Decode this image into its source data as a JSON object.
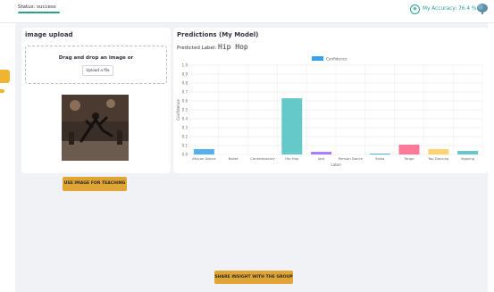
{
  "header": {
    "status": "Status: success",
    "accuracy": "My Accuracy: 76.4 %",
    "accuracy_icon": "circle-icon",
    "brain_icon": "brain-icon"
  },
  "upload": {
    "title": "image upload",
    "drop_text": "Drag and drop an image or",
    "button_label": "Upload a file"
  },
  "actions": {
    "teach_label": "USE IMAGE FOR TEACHING",
    "share_label": "SHARE INSIGHT WITH THE GROUP"
  },
  "predictions": {
    "title": "Predictions (My Model)",
    "label_prefix": "Predicted Label:",
    "label_value": "Hip Hop"
  },
  "colors": {
    "accent": "#2aa198",
    "button": "#e0a534"
  },
  "chart_data": {
    "type": "bar",
    "title": "",
    "xlabel": "Label",
    "ylabel": "Confidence",
    "ylim": [
      0,
      1.0
    ],
    "yticks": [
      "0.0",
      "0.1",
      "0.2",
      "0.3",
      "0.4",
      "0.5",
      "0.6",
      "0.7",
      "0.8",
      "0.9",
      "1.0"
    ],
    "legend": "Confidence",
    "legend_position": "top-center",
    "grid": true,
    "categories": [
      "African Dance",
      "Ballet",
      "Contemporary",
      "Hip Hop",
      "Jazz",
      "Persian Dance",
      "Salsa",
      "Tango",
      "Tap Dancing",
      "Voguing"
    ],
    "values": [
      0.06,
      0.0,
      0.0,
      0.63,
      0.03,
      0.0,
      0.01,
      0.11,
      0.06,
      0.04
    ],
    "bar_colors": [
      "#36a2eb",
      "#ff6384",
      "#ff9f40",
      "#4bc0c0",
      "#9966ff",
      "#ff6384",
      "#36a2eb",
      "#ff6384",
      "#ffcd56",
      "#4bc0c0"
    ],
    "legend_color": "#36a2eb"
  }
}
